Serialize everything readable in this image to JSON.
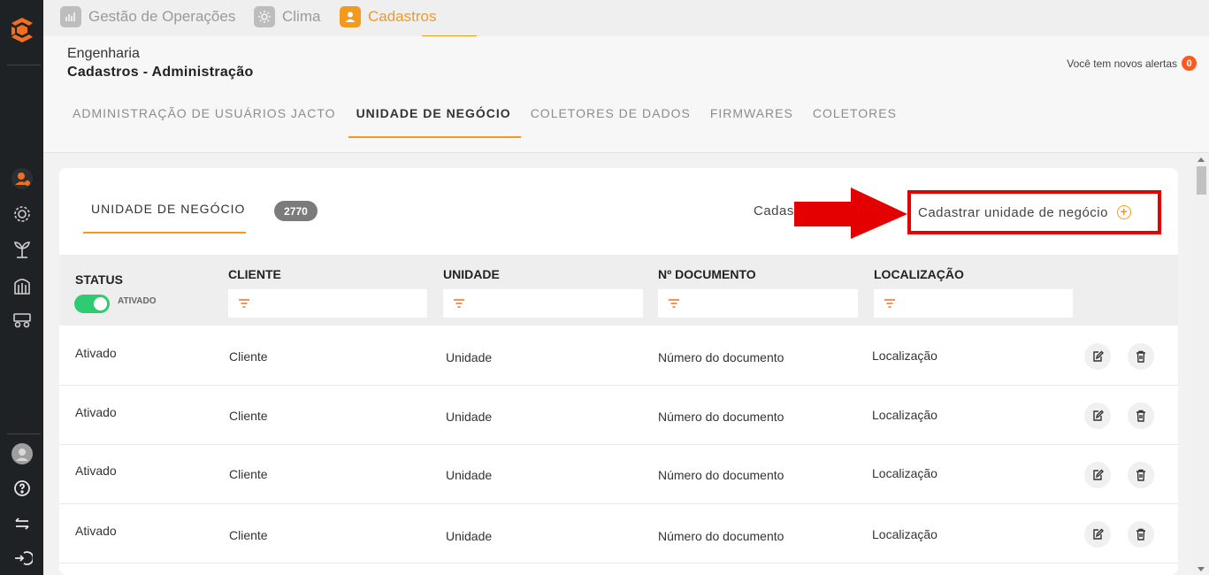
{
  "topbar": {
    "tabs": [
      {
        "label": "Gestão de Operações",
        "icon": "chart-icon"
      },
      {
        "label": "Clima",
        "icon": "sun-icon"
      },
      {
        "label": "Cadastros",
        "icon": "user-icon"
      }
    ],
    "active_tab": "Cadastros"
  },
  "header": {
    "breadcrumb_1": "Engenharia",
    "breadcrumb_2": "Cadastros - Administração",
    "alerts_text": "Você tem novos alertas",
    "alerts_count": "0"
  },
  "subtabs": [
    "ADMINISTRAÇÃO DE USUÁRIOS JACTO",
    "UNIDADE DE NEGÓCIO",
    "COLETORES DE DADOS",
    "FIRMWARES",
    "COLETORES"
  ],
  "card": {
    "tab_label": "UNIDADE DE NEGÓCIO",
    "count": "2770",
    "partial_text": "Cadas",
    "register_button": "Cadastrar unidade de negócio"
  },
  "filters": {
    "status_header": "STATUS",
    "toggle_label": "ATIVADO",
    "columns": [
      "CLIENTE",
      "UNIDADE",
      "Nº DOCUMENTO",
      "LOCALIZAÇÃO"
    ]
  },
  "rows": [
    {
      "status": "Ativado",
      "cliente": "Cliente",
      "unidade": "Unidade",
      "documento": "Número do documento",
      "localizacao": "Localização"
    },
    {
      "status": "Ativado",
      "cliente": "Cliente",
      "unidade": "Unidade",
      "documento": "Número do documento",
      "localizacao": "Localização"
    },
    {
      "status": "Ativado",
      "cliente": "Cliente",
      "unidade": "Unidade",
      "documento": "Número do documento",
      "localizacao": "Localização"
    },
    {
      "status": "Ativado",
      "cliente": "Cliente",
      "unidade": "Unidade",
      "documento": "Número do documento",
      "localizacao": "Localização"
    }
  ],
  "colors": {
    "accent": "#f39a1e",
    "sidebar": "#1f2224",
    "toggle_on": "#2ecc71",
    "highlight": "#e40000"
  }
}
